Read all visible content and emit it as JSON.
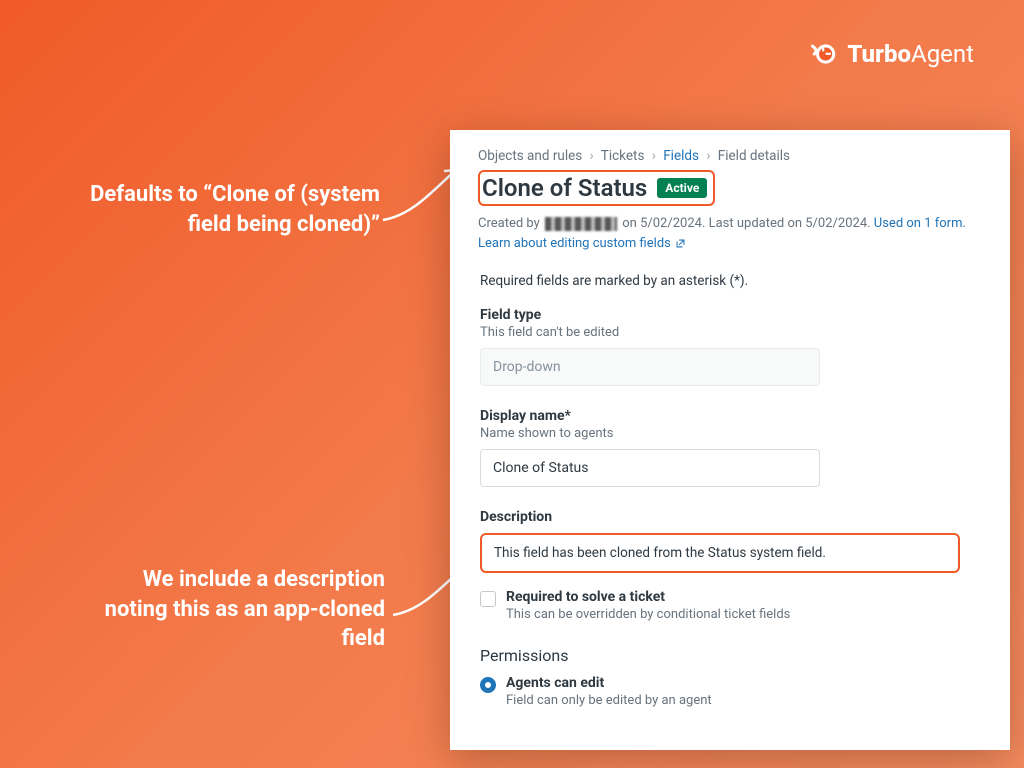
{
  "logo": {
    "brand_bold": "Turbo",
    "brand_light": "Agent"
  },
  "annotations": {
    "a1": "Defaults to “Clone of (system field being cloned)”",
    "a2": "We include a description noting this as an app-cloned field"
  },
  "breadcrumb": {
    "c1": "Objects and rules",
    "c2": "Tickets",
    "c3": "Fields",
    "c4": "Field details",
    "sep": "›"
  },
  "header": {
    "title": "Clone of Status",
    "badge": "Active",
    "created_prefix": "Created by",
    "created_suffix": "on 5/02/2024. Last updated on 5/02/2024.",
    "used_on": "Used on 1 form.",
    "learn": "Learn about editing custom fields"
  },
  "form": {
    "req_note": "Required fields are marked by an asterisk (*).",
    "field_type_label": "Field type",
    "field_type_sub": "This field can't be edited",
    "field_type_value": "Drop-down",
    "display_label": "Display name*",
    "display_sub": "Name shown to agents",
    "display_value": "Clone of Status",
    "desc_label": "Description",
    "desc_value": "This field has been cloned from the Status system field.",
    "req_solve_label": "Required to solve a ticket",
    "req_solve_sub": "This can be overridden by conditional ticket fields",
    "permissions_head": "Permissions",
    "radio1_label": "Agents can edit",
    "radio1_sub": "Field can only be edited by an agent"
  }
}
